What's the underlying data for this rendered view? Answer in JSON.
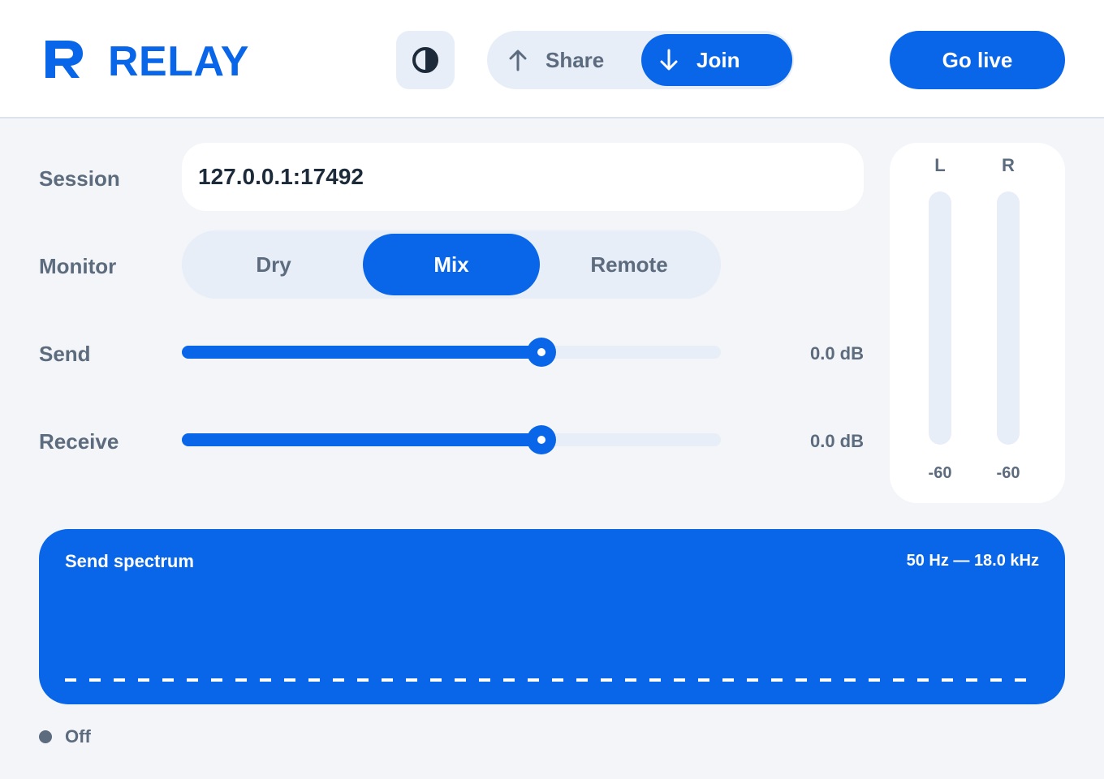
{
  "app": {
    "brand": "RELAY",
    "logo_icon": "relay-logo-icon",
    "accent": "#0a66e8"
  },
  "header": {
    "theme_icon": "contrast-icon",
    "mode": {
      "share_label": "Share",
      "share_icon": "arrow-up-icon",
      "join_label": "Join",
      "join_icon": "arrow-down-icon",
      "selected": "Join"
    },
    "go_live_label": "Go live"
  },
  "session": {
    "label": "Session",
    "value": "127.0.0.1:17492"
  },
  "monitor": {
    "label": "Monitor",
    "options": [
      "Dry",
      "Mix",
      "Remote"
    ],
    "selected": "Mix"
  },
  "send": {
    "label": "Send",
    "value_text": "0.0 dB",
    "level": 0.667
  },
  "receive": {
    "label": "Receive",
    "value_text": "0.0 dB",
    "level": 0.667
  },
  "meters": [
    {
      "label": "L",
      "value": "-60",
      "level": 0
    },
    {
      "label": "R",
      "value": "-60",
      "level": 0
    }
  ],
  "spectrum": {
    "title": "Send spectrum",
    "range": "50 Hz — 18.0 kHz"
  },
  "status": {
    "text": "Off",
    "color": "#5c6b7d"
  }
}
